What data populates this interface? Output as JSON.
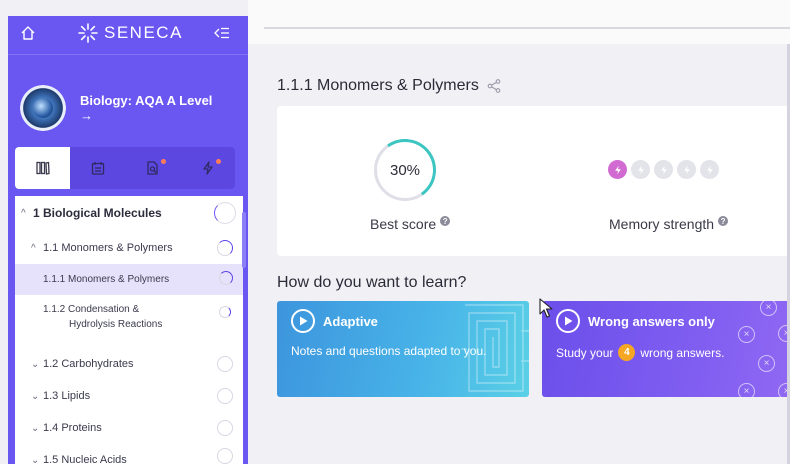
{
  "sidebar": {
    "brand": "SENECA",
    "course_title": "Biology: AQA A Level",
    "course_arrow": "→",
    "tabs": [
      {
        "icon": "book-icon",
        "active": true
      },
      {
        "icon": "calendar-icon",
        "active": false
      },
      {
        "icon": "document-search-icon",
        "active": false,
        "dot": true
      },
      {
        "icon": "lightning-icon",
        "active": false,
        "dot": true
      }
    ],
    "toc": [
      {
        "chevron": "^",
        "label": "1 Biological Molecules",
        "level": "chapter"
      },
      {
        "chevron": "^",
        "label": "1.1 Monomers & Polymers",
        "level": "section"
      },
      {
        "label": "1.1.1 Monomers & Polymers",
        "level": "topic",
        "selected": true
      },
      {
        "label": "1.1.2 Condensation &",
        "label_line2": "Hydrolysis Reactions",
        "level": "topic"
      },
      {
        "chevron": "v",
        "label": "1.2 Carbohydrates",
        "level": "section"
      },
      {
        "chevron": "v",
        "label": "1.3 Lipids",
        "level": "section"
      },
      {
        "chevron": "v",
        "label": "1.4 Proteins",
        "level": "section"
      },
      {
        "chevron": "v",
        "label": "1.5 Nucleic Acids",
        "level": "section"
      }
    ]
  },
  "main": {
    "topic_title": "1.1.1 Monomers & Polymers",
    "best_score_value": "30%",
    "best_score_fraction": 0.3,
    "best_score_label": "Best score",
    "memory_strength_label": "Memory strength",
    "memory_strength_level": 1,
    "memory_strength_max": 5,
    "learn_heading": "How do you want to learn?",
    "modes": {
      "adaptive": {
        "title": "Adaptive",
        "description": "Notes and questions adapted to you."
      },
      "wrong": {
        "title": "Wrong answers only",
        "desc_prefix": "Study your",
        "count": "4",
        "desc_suffix": "wrong answers."
      }
    }
  },
  "colors": {
    "sidebar": "#6a56f1",
    "accent_teal": "#3cc6c1",
    "memory_on": "#d16bd1",
    "badge_orange": "#f5a623"
  }
}
